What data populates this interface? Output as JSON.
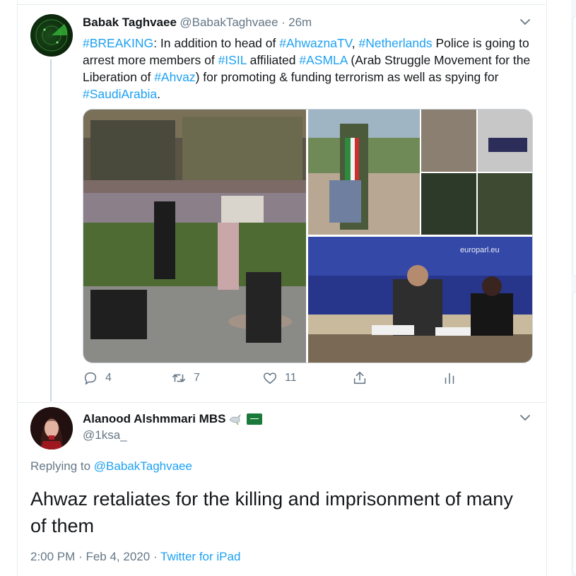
{
  "tweet1": {
    "name": "Babak Taghvaee",
    "handle": "@BabakTaghvaee",
    "sep": "·",
    "time": "26m",
    "text_parts": {
      "t1": "#BREAKING",
      "p1": ": In addition to head of ",
      "t2": "#AhwaznaTV",
      "p2": ", ",
      "t3": "#Netherlands",
      "p3": " Police is going to arrest more members of ",
      "t4": "#ISIL",
      "p4": " affiliated ",
      "t5": "#ASMLA",
      "p5": " (Arab Struggle Movement for the Liberation of ",
      "t6": "#Ahvaz",
      "p6": ") for promoting & funding terrorism as well as spying for ",
      "t7": "#SaudiArabia",
      "p7": "."
    },
    "image_watermark": "europarl.eu",
    "actions": {
      "reply_count": "4",
      "retweet_count": "7",
      "like_count": "11"
    }
  },
  "tweet2": {
    "name": "Alanood Alshmmari MBS",
    "handle": "@1ksa_",
    "replying_label": "Replying to ",
    "replying_handle": "@BabakTaghvaee",
    "text": "Ahwaz retaliates for the killing and imprisonment of many of them",
    "time": "2:00 PM",
    "sep1": "·",
    "date": "Feb 4, 2020",
    "sep2": "·",
    "source": "Twitter for iPad"
  },
  "colors": {
    "link": "#1da1f2",
    "text": "#14171a",
    "muted": "#657786",
    "border": "#e6ecf0"
  },
  "icons": [
    "reply-icon",
    "retweet-icon",
    "like-icon",
    "share-icon",
    "analytics-icon",
    "chevron-down-icon",
    "dove-icon",
    "saudi-flag-icon"
  ]
}
